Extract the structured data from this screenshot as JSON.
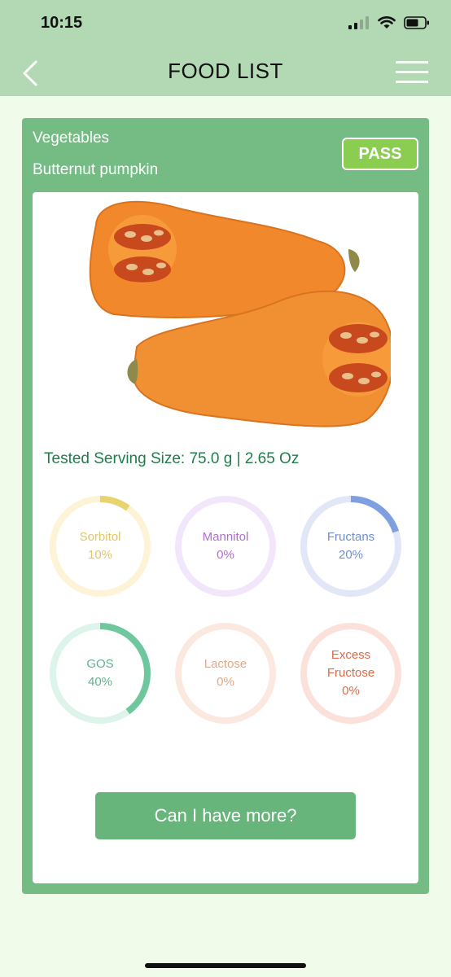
{
  "status": {
    "time": "10:15"
  },
  "nav": {
    "title": "FOOD LIST"
  },
  "food": {
    "category": "Vegetables",
    "name": "Butternut pumpkin",
    "verdict": "PASS",
    "serving": "Tested Serving Size: 75.0 g | 2.65 Oz"
  },
  "nutrients": [
    {
      "label": "Sorbitol",
      "value": "10%",
      "percent": 10,
      "color": "#e8d36e",
      "track": "#fdf3d6",
      "text": "#e2c567"
    },
    {
      "label": "Mannitol",
      "value": "0%",
      "percent": 0,
      "color": "#c78be0",
      "track": "#f2e6fb",
      "text": "#b46ad5"
    },
    {
      "label": "Fructans",
      "value": "20%",
      "percent": 20,
      "color": "#7f9fe0",
      "track": "#e1e7f7",
      "text": "#6f8fd0"
    },
    {
      "label": "GOS",
      "value": "40%",
      "percent": 40,
      "color": "#6fc79e",
      "track": "#dcf4ea",
      "text": "#5cb58c"
    },
    {
      "label": "Lactose",
      "value": "0%",
      "percent": 0,
      "color": "#f0b99a",
      "track": "#fbe9e0",
      "text": "#e4a886"
    },
    {
      "label": "Excess\nFructose",
      "value": "0%",
      "percent": 0,
      "color": "#ef9f8d",
      "track": "#fbe1da",
      "text": "#de6a48"
    }
  ],
  "action": {
    "more_label": "Can I have more?"
  }
}
